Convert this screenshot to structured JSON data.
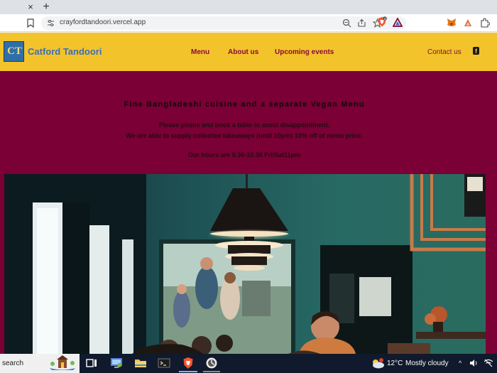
{
  "browser": {
    "tab_close": "×",
    "tab_new": "+",
    "url": "crayfordtandoori.vercel.app",
    "rewards_badge": "3"
  },
  "site": {
    "logo_text": "CT",
    "brand": "Catford Tandoori",
    "nav": {
      "menu": "Menu",
      "about": "About us",
      "events": "Upcoming events",
      "contact": "Contact us",
      "facebook_glyph": "f"
    },
    "headline": "Fine Bangladeshi cuisine and a separate Vegan Menu",
    "line1": "Please phone and book a table to avoid disappointment.",
    "line2": "We are able to supply collected takeaways (until 10pm) 10% off of menu price.",
    "line3": "Our hours are 5.30-10.30 Fri/Sat11pm",
    "colors": {
      "nav_bg": "#f3c32b",
      "page_bg": "#7a0035",
      "nav_link": "#8a0b3a",
      "brand": "#3d6fb8"
    }
  },
  "taskbar": {
    "search": "search",
    "weather_temp": "12°C",
    "weather_desc": "Mostly cloudy",
    "tray_chevron": "^"
  }
}
